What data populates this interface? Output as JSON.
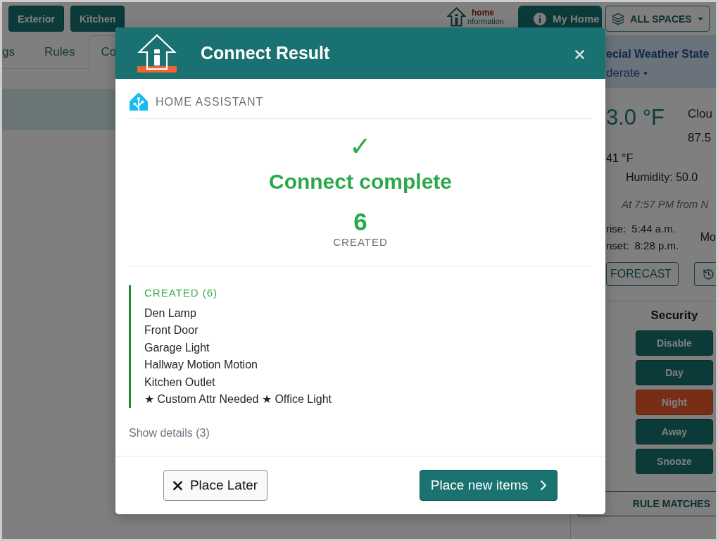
{
  "top_bar": {
    "room_buttons": [
      "Exterior",
      "Kitchen"
    ],
    "logo": [
      "home",
      "nformation"
    ],
    "my_home_button": "My Home",
    "spaces_menu": "ALL SPACES"
  },
  "tabs": [
    {
      "label": "gs",
      "selected": false
    },
    {
      "label": "Rules",
      "selected": false
    },
    {
      "label": "Co",
      "selected": true
    }
  ],
  "weather": {
    "title": "ecial Weather State",
    "subtitle": "derate •",
    "temperature": "3.0 °F",
    "condition": "Clou",
    "reading": "87.5",
    "low": "41 °F",
    "humidity": "Humidity: 50.0",
    "observed": "At 7:57 PM from N",
    "sunrise": {
      "label": "rise:",
      "time": "5:44 a.m."
    },
    "sunset": {
      "label": "nset:",
      "time": "8:28 p.m."
    },
    "moon": "Mo",
    "forecast_button": "FORECAST"
  },
  "security": {
    "title": "Security",
    "modes": [
      {
        "label": "Disable",
        "selected": false
      },
      {
        "label": "Day",
        "selected": false
      },
      {
        "label": "Night",
        "selected": true
      },
      {
        "label": "Away",
        "selected": false
      },
      {
        "label": "Snooze",
        "selected": false
      }
    ]
  },
  "rule_matches_button": "RULE MATCHES",
  "dialog": {
    "title": "Connect Result",
    "source": "HOME ASSISTANT",
    "status_mark": "✓",
    "status": "Connect complete",
    "count": "6",
    "count_label": "CREATED",
    "section": {
      "heading": "CREATED (6)",
      "items": [
        "Den Lamp",
        "Front Door",
        "Garage Light",
        "Hallway Motion Motion",
        "Kitchen Outlet",
        "★ Custom Attr Needed ★ Office Light"
      ]
    },
    "details_toggle": "Show details (3)",
    "buttons": [
      {
        "kind": "secondary",
        "label": "Place Later"
      },
      {
        "kind": "primary",
        "label": "Place new items"
      }
    ]
  }
}
